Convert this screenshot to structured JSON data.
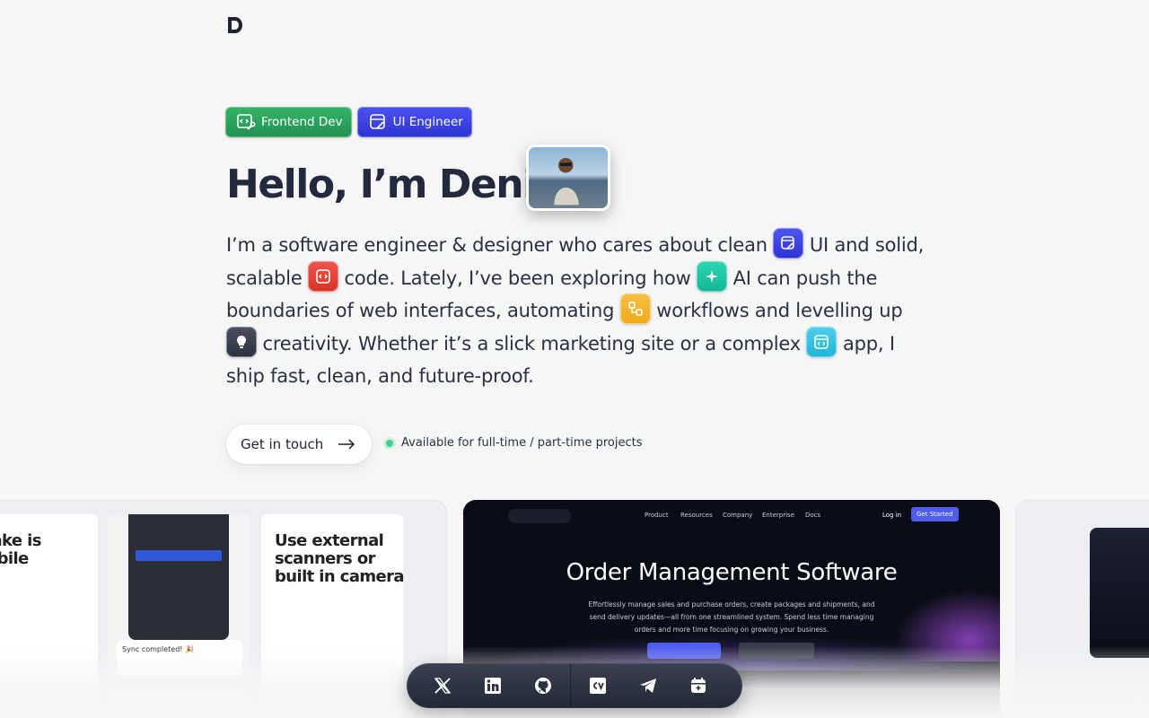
{
  "header": {
    "logo_alt": "D"
  },
  "badges": [
    {
      "label": "Frontend Dev",
      "icon": "code-wrench-icon",
      "color": "#2ca55d"
    },
    {
      "label": "UI Engineer",
      "icon": "window-pen-icon",
      "color": "#3a40e6"
    }
  ],
  "hero": {
    "title": "Hello, I’m Denis!",
    "avatar_alt": "Denis photo",
    "intro": {
      "p1": "I’m a software engineer & designer who cares about clean",
      "p2": "UI and solid, scalable",
      "p3": "code. Lately, I’ve been exploring how",
      "p4": "AI can push the boundaries of web interfaces, automating",
      "p5": "workflows and levelling up",
      "p6": "creativity. Whether it’s a slick marketing site or a complex",
      "p7": "app, I ship fast, clean, and future-proof."
    },
    "cta_label": "Get in touch",
    "availability": "Available for full-time / part-time projects"
  },
  "projects": {
    "card1": {
      "phone1_text": "cktake is\n mobile\n fun",
      "phone2_status": "Sync completed! 🎉",
      "phone3_text": "Use external\nscanners or\nbuilt in camera"
    },
    "card2": {
      "nav": [
        "Product",
        "Resources",
        "Company",
        "Enterprise",
        "Docs"
      ],
      "login": "Log in",
      "get_started": "Get Started",
      "title": "Order Management Software",
      "subtitle": "Effortlessly manage sales and purchase orders, create packages and shipments, and send delivery updates—all from one streamlined system. Spend less time managing orders and more time focusing on growing your business."
    }
  },
  "dock": [
    {
      "name": "x-twitter",
      "icon": "x-icon"
    },
    {
      "name": "linkedin",
      "icon": "linkedin-icon"
    },
    {
      "name": "github",
      "icon": "github-icon"
    },
    {
      "name": "cv",
      "icon": "cv-icon"
    },
    {
      "name": "telegram",
      "icon": "telegram-icon"
    },
    {
      "name": "calendar",
      "icon": "calendar-icon"
    }
  ]
}
